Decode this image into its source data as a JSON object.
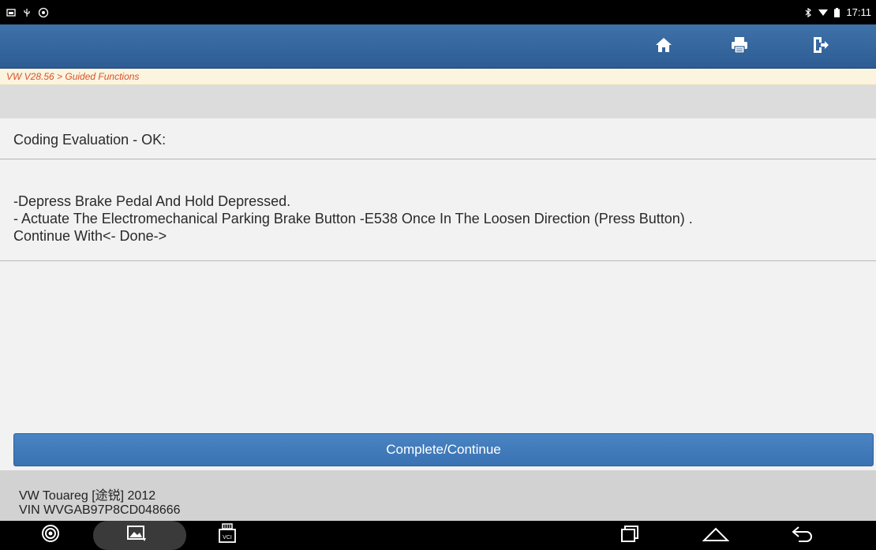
{
  "status_bar": {
    "time": "17:11",
    "icons_left": [
      "screenshot-icon",
      "usb-icon",
      "settings-icon"
    ],
    "icons_right": [
      "bluetooth-icon",
      "wifi-icon",
      "battery-icon"
    ]
  },
  "toolbar": {
    "buttons": [
      "home-icon",
      "print-icon",
      "exit-icon"
    ]
  },
  "breadcrumb": "VW V28.56 > Guided Functions",
  "coding_evaluation": "Coding Evaluation - OK:",
  "instructions": {
    "line1": "-Depress Brake Pedal And Hold Depressed.",
    "line2": "- Actuate The Electromechanical Parking Brake Button -E538 Once In The Loosen Direction (Press Button) .",
    "line3": " Continue With<- Done->"
  },
  "complete_button": "Complete/Continue",
  "vehicle": {
    "model": "VW Touareg [途锐] 2012",
    "vin": "VIN WVGAB97P8CD048666"
  },
  "nav_bar": {
    "vci_label": "VCI",
    "icons": [
      "browser-icon",
      "gallery-icon",
      "vci-icon",
      "recent-apps-icon",
      "android-home-icon",
      "back-icon"
    ]
  },
  "colors": {
    "topbar": "#3a6aa0",
    "breadcrumb_text": "#d9512c",
    "button": "#4178b8"
  }
}
